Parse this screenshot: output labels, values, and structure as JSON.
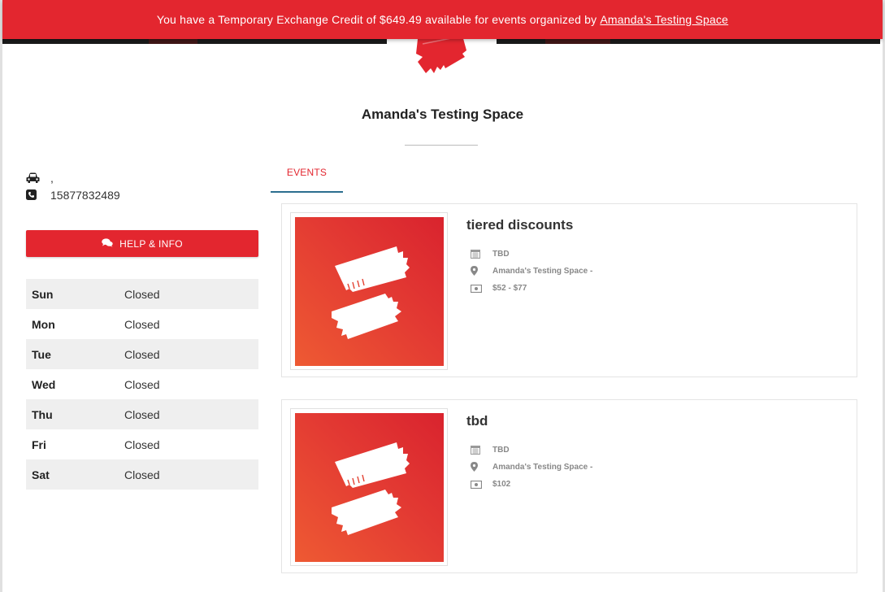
{
  "notice": {
    "text": "You have a Temporary Exchange Credit of $649.49 available for events organized by",
    "link": "Amanda's Testing Space"
  },
  "organizer": {
    "name": "Amanda's Testing Space",
    "address": ",",
    "phone": "15877832489",
    "help_label": "HELP & INFO"
  },
  "hours": [
    {
      "day": "Sun",
      "status": "Closed"
    },
    {
      "day": "Mon",
      "status": "Closed"
    },
    {
      "day": "Tue",
      "status": "Closed"
    },
    {
      "day": "Wed",
      "status": "Closed"
    },
    {
      "day": "Thu",
      "status": "Closed"
    },
    {
      "day": "Fri",
      "status": "Closed"
    },
    {
      "day": "Sat",
      "status": "Closed"
    }
  ],
  "tabs": [
    {
      "label": "EVENTS"
    }
  ],
  "events": [
    {
      "title": "tiered discounts",
      "date": "TBD",
      "venue": "Amanda's Testing Space -",
      "price": "$52 - $77"
    },
    {
      "title": "tbd",
      "date": "TBD",
      "venue": "Amanda's Testing Space -",
      "price": "$102"
    }
  ],
  "colors": {
    "brand_red": "#e3262f",
    "tab_underline": "#2c6e8f"
  },
  "icons": [
    "car-icon",
    "phone-icon",
    "chat-icon",
    "calendar-icon",
    "map-marker-icon",
    "money-icon",
    "ticket-logo-icon"
  ]
}
